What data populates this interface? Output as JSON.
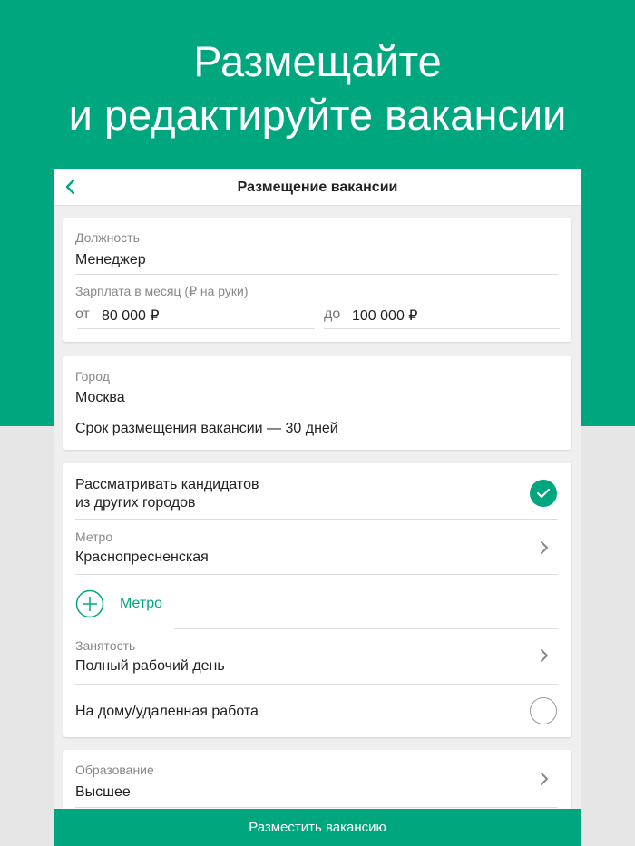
{
  "hero": {
    "line1": "Размещайте",
    "line2": "и редактируйте вакансии"
  },
  "navbar": {
    "title": "Размещение вакансии"
  },
  "position": {
    "label": "Должность",
    "value": "Менеджер"
  },
  "salary": {
    "label": "Зарплата в месяц (₽ на руки)",
    "from_prefix": "от",
    "from_value": "80 000 ₽",
    "to_prefix": "до",
    "to_value": "100 000 ₽"
  },
  "city": {
    "label": "Город",
    "value": "Москва"
  },
  "duration": {
    "text": "Срок размещения вакансии — 30 дней"
  },
  "other_cities": {
    "line1": "Рассматривать кандидатов",
    "line2": "из других городов",
    "checked": true
  },
  "metro": {
    "label": "Метро",
    "value": "Краснопресненская",
    "add_label": "Метро"
  },
  "employment": {
    "label": "Занятость",
    "value": "Полный рабочий день"
  },
  "remote": {
    "label": "На дому/удаленная работа",
    "checked": false
  },
  "education": {
    "label": "Образование",
    "value": "Высшее"
  },
  "submit": {
    "label": "Разместить вакансию"
  },
  "colors": {
    "accent": "#00a77e",
    "background": "#e6e6e6"
  }
}
